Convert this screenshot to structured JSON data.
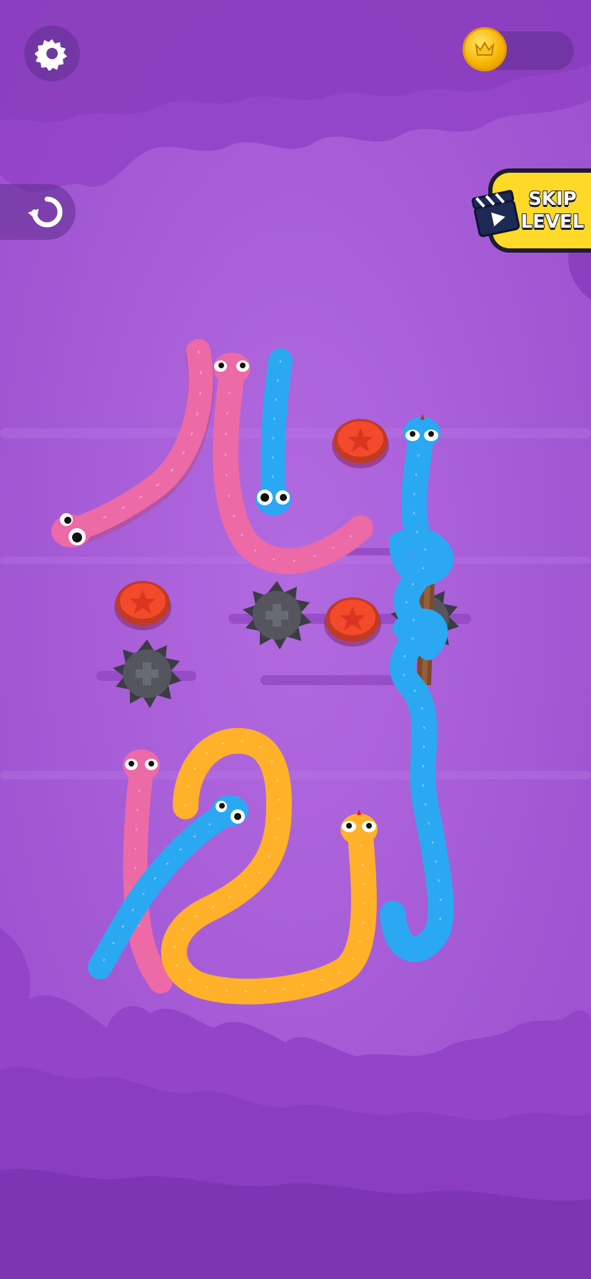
{
  "hud": {
    "settings_icon": "gear-icon",
    "undo_icon": "undo-icon",
    "coin_icon": "crown-coin-icon",
    "coin_count": "",
    "skip_level": {
      "line1": "SKIP",
      "line2": "LEVEL",
      "icon": "clapperboard-play-icon"
    }
  },
  "colors": {
    "background": "#a75ad9",
    "pink_snake": "#ec6aa6",
    "blue_snake": "#2aa9f2",
    "yellow_snake": "#ffb12a",
    "button_red": "#f24a2a",
    "spike_mine": "#4a4a52",
    "skip_button": "#ffd928"
  },
  "board": {
    "snakes": [
      {
        "color": "pink",
        "name": "pink-snake-left"
      },
      {
        "color": "pink",
        "name": "pink-snake-middle"
      },
      {
        "color": "blue",
        "name": "blue-snake-top"
      },
      {
        "color": "blue",
        "name": "blue-snake-tied"
      },
      {
        "color": "pink",
        "name": "pink-snake-bottom"
      },
      {
        "color": "blue",
        "name": "blue-snake-bottom"
      },
      {
        "color": "yellow",
        "name": "yellow-snake"
      }
    ],
    "red_buttons": 3,
    "spike_mines": 3,
    "stake": 1
  }
}
